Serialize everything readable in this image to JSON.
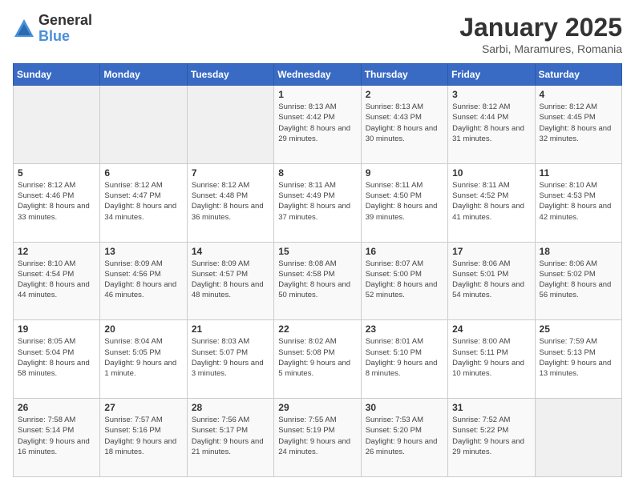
{
  "logo": {
    "general": "General",
    "blue": "Blue"
  },
  "title": "January 2025",
  "location": "Sarbi, Maramures, Romania",
  "weekdays": [
    "Sunday",
    "Monday",
    "Tuesday",
    "Wednesday",
    "Thursday",
    "Friday",
    "Saturday"
  ],
  "weeks": [
    [
      {
        "day": "",
        "info": ""
      },
      {
        "day": "",
        "info": ""
      },
      {
        "day": "",
        "info": ""
      },
      {
        "day": "1",
        "info": "Sunrise: 8:13 AM\nSunset: 4:42 PM\nDaylight: 8 hours and 29 minutes."
      },
      {
        "day": "2",
        "info": "Sunrise: 8:13 AM\nSunset: 4:43 PM\nDaylight: 8 hours and 30 minutes."
      },
      {
        "day": "3",
        "info": "Sunrise: 8:12 AM\nSunset: 4:44 PM\nDaylight: 8 hours and 31 minutes."
      },
      {
        "day": "4",
        "info": "Sunrise: 8:12 AM\nSunset: 4:45 PM\nDaylight: 8 hours and 32 minutes."
      }
    ],
    [
      {
        "day": "5",
        "info": "Sunrise: 8:12 AM\nSunset: 4:46 PM\nDaylight: 8 hours and 33 minutes."
      },
      {
        "day": "6",
        "info": "Sunrise: 8:12 AM\nSunset: 4:47 PM\nDaylight: 8 hours and 34 minutes."
      },
      {
        "day": "7",
        "info": "Sunrise: 8:12 AM\nSunset: 4:48 PM\nDaylight: 8 hours and 36 minutes."
      },
      {
        "day": "8",
        "info": "Sunrise: 8:11 AM\nSunset: 4:49 PM\nDaylight: 8 hours and 37 minutes."
      },
      {
        "day": "9",
        "info": "Sunrise: 8:11 AM\nSunset: 4:50 PM\nDaylight: 8 hours and 39 minutes."
      },
      {
        "day": "10",
        "info": "Sunrise: 8:11 AM\nSunset: 4:52 PM\nDaylight: 8 hours and 41 minutes."
      },
      {
        "day": "11",
        "info": "Sunrise: 8:10 AM\nSunset: 4:53 PM\nDaylight: 8 hours and 42 minutes."
      }
    ],
    [
      {
        "day": "12",
        "info": "Sunrise: 8:10 AM\nSunset: 4:54 PM\nDaylight: 8 hours and 44 minutes."
      },
      {
        "day": "13",
        "info": "Sunrise: 8:09 AM\nSunset: 4:56 PM\nDaylight: 8 hours and 46 minutes."
      },
      {
        "day": "14",
        "info": "Sunrise: 8:09 AM\nSunset: 4:57 PM\nDaylight: 8 hours and 48 minutes."
      },
      {
        "day": "15",
        "info": "Sunrise: 8:08 AM\nSunset: 4:58 PM\nDaylight: 8 hours and 50 minutes."
      },
      {
        "day": "16",
        "info": "Sunrise: 8:07 AM\nSunset: 5:00 PM\nDaylight: 8 hours and 52 minutes."
      },
      {
        "day": "17",
        "info": "Sunrise: 8:06 AM\nSunset: 5:01 PM\nDaylight: 8 hours and 54 minutes."
      },
      {
        "day": "18",
        "info": "Sunrise: 8:06 AM\nSunset: 5:02 PM\nDaylight: 8 hours and 56 minutes."
      }
    ],
    [
      {
        "day": "19",
        "info": "Sunrise: 8:05 AM\nSunset: 5:04 PM\nDaylight: 8 hours and 58 minutes."
      },
      {
        "day": "20",
        "info": "Sunrise: 8:04 AM\nSunset: 5:05 PM\nDaylight: 9 hours and 1 minute."
      },
      {
        "day": "21",
        "info": "Sunrise: 8:03 AM\nSunset: 5:07 PM\nDaylight: 9 hours and 3 minutes."
      },
      {
        "day": "22",
        "info": "Sunrise: 8:02 AM\nSunset: 5:08 PM\nDaylight: 9 hours and 5 minutes."
      },
      {
        "day": "23",
        "info": "Sunrise: 8:01 AM\nSunset: 5:10 PM\nDaylight: 9 hours and 8 minutes."
      },
      {
        "day": "24",
        "info": "Sunrise: 8:00 AM\nSunset: 5:11 PM\nDaylight: 9 hours and 10 minutes."
      },
      {
        "day": "25",
        "info": "Sunrise: 7:59 AM\nSunset: 5:13 PM\nDaylight: 9 hours and 13 minutes."
      }
    ],
    [
      {
        "day": "26",
        "info": "Sunrise: 7:58 AM\nSunset: 5:14 PM\nDaylight: 9 hours and 16 minutes."
      },
      {
        "day": "27",
        "info": "Sunrise: 7:57 AM\nSunset: 5:16 PM\nDaylight: 9 hours and 18 minutes."
      },
      {
        "day": "28",
        "info": "Sunrise: 7:56 AM\nSunset: 5:17 PM\nDaylight: 9 hours and 21 minutes."
      },
      {
        "day": "29",
        "info": "Sunrise: 7:55 AM\nSunset: 5:19 PM\nDaylight: 9 hours and 24 minutes."
      },
      {
        "day": "30",
        "info": "Sunrise: 7:53 AM\nSunset: 5:20 PM\nDaylight: 9 hours and 26 minutes."
      },
      {
        "day": "31",
        "info": "Sunrise: 7:52 AM\nSunset: 5:22 PM\nDaylight: 9 hours and 29 minutes."
      },
      {
        "day": "",
        "info": ""
      }
    ]
  ]
}
